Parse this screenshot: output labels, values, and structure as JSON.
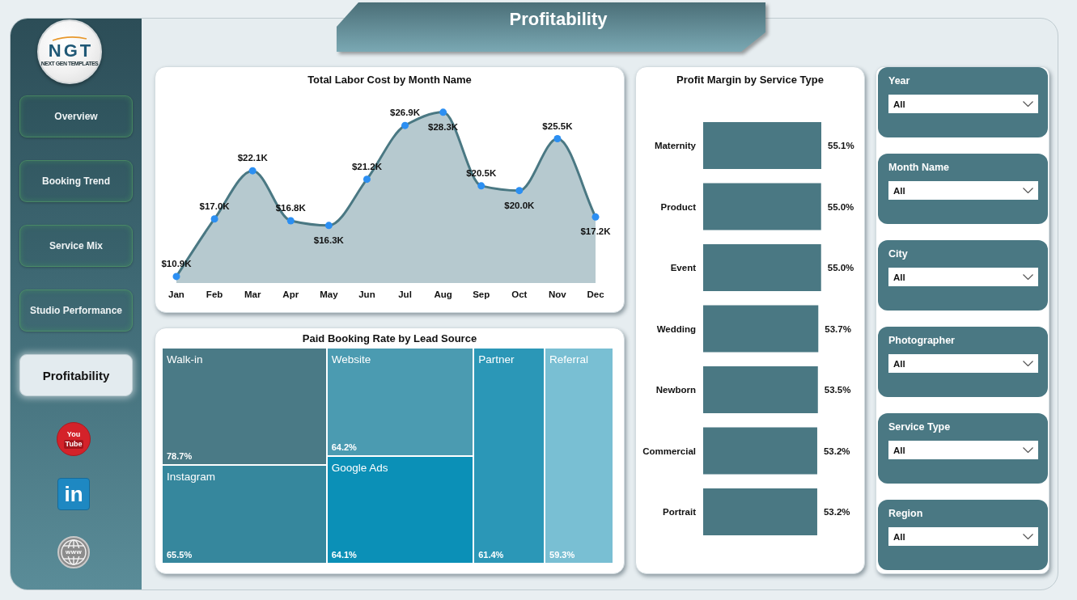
{
  "page_title": "Profitability",
  "sidebar": {
    "logo": {
      "mark": "NGT",
      "tagline": "NEXT GEN TEMPLATES"
    },
    "nav_items": [
      {
        "label": "Overview",
        "selected": false
      },
      {
        "label": "Booking Trend",
        "selected": false
      },
      {
        "label": "Service Mix",
        "selected": false
      },
      {
        "label": "Studio Performance",
        "selected": false
      },
      {
        "label": "Profitability",
        "selected": true
      }
    ],
    "social_links": [
      {
        "kind": "video",
        "lines": [
          "You",
          "Tube"
        ]
      },
      {
        "kind": "network",
        "lines": [
          "in"
        ]
      },
      {
        "kind": "web",
        "lines": [
          "www"
        ]
      }
    ]
  },
  "labor_cost_chart": {
    "chart_data": {
      "type": "area",
      "title": "Total Labor Cost by Month Name",
      "categories": [
        "Jan",
        "Feb",
        "Mar",
        "Apr",
        "May",
        "Jun",
        "Jul",
        "Aug",
        "Sep",
        "Oct",
        "Nov",
        "Dec"
      ],
      "values": [
        10.9,
        17.0,
        22.1,
        16.8,
        16.3,
        21.2,
        26.9,
        28.3,
        20.5,
        20.0,
        25.5,
        17.2
      ],
      "value_labels": [
        "$10.9K",
        "$17.0K",
        "$22.1K",
        "$16.8K",
        "$16.3K",
        "$21.2K",
        "$26.9K",
        "$28.3K",
        "$20.5K",
        "$20.0K",
        "$25.5K",
        "$17.2K"
      ]
    }
  },
  "lead_source_treemap": {
    "title": "Paid Booking Rate by Lead Source",
    "tiles": [
      {
        "source": "Walk-in",
        "rate": "78.7%",
        "color": "#4a7a86"
      },
      {
        "source": "Instagram",
        "rate": "65.5%",
        "color": "#36879d"
      },
      {
        "source": "Website",
        "rate": "64.2%",
        "color": "#4b9bb1"
      },
      {
        "source": "Google Ads",
        "rate": "64.1%",
        "color": "#0b90b7"
      },
      {
        "source": "Partner",
        "rate": "61.4%",
        "color": "#2b97b7"
      },
      {
        "source": "Referral",
        "rate": "59.3%",
        "color": "#79bfd3"
      }
    ]
  },
  "profit_margin_chart": {
    "chart_data": {
      "type": "bar",
      "orientation": "horizontal",
      "title": "Profit Margin by Service Type",
      "categories": [
        "Maternity",
        "Product",
        "Event",
        "Wedding",
        "Newborn",
        "Commercial",
        "Portrait"
      ],
      "values": [
        55.1,
        55.0,
        55.0,
        53.7,
        53.5,
        53.2,
        53.2
      ],
      "xlim": [
        0,
        55.1
      ],
      "value_labels": [
        "55.1%",
        "55.0%",
        "55.0%",
        "53.7%",
        "53.5%",
        "53.2%",
        "53.2%"
      ]
    }
  },
  "filters": [
    {
      "label": "Year",
      "value": "All"
    },
    {
      "label": "Month Name",
      "value": "All"
    },
    {
      "label": "City",
      "value": "All"
    },
    {
      "label": "Photographer",
      "value": "All"
    },
    {
      "label": "Service Type",
      "value": "All"
    },
    {
      "label": "Region",
      "value": "All"
    }
  ]
}
